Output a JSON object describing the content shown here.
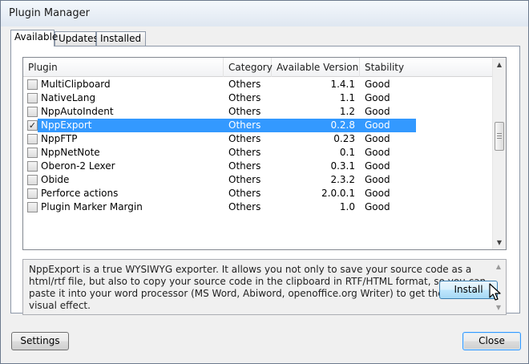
{
  "window": {
    "title": "Plugin Manager"
  },
  "tabs": [
    {
      "label": "Available",
      "active": true
    },
    {
      "label": "Updates",
      "active": false
    },
    {
      "label": "Installed",
      "active": false
    }
  ],
  "plugin_list": {
    "columns": [
      "Plugin",
      "Category",
      "Available Version",
      "Stability"
    ],
    "rows": [
      {
        "name": "MultiClipboard",
        "category": "Others",
        "version": "1.4.1",
        "stability": "Good",
        "checked": false,
        "selected": false
      },
      {
        "name": "NativeLang",
        "category": "Others",
        "version": "1.1",
        "stability": "Good",
        "checked": false,
        "selected": false
      },
      {
        "name": "NppAutoIndent",
        "category": "Others",
        "version": "1.2",
        "stability": "Good",
        "checked": false,
        "selected": false
      },
      {
        "name": "NppExport",
        "category": "Others",
        "version": "0.2.8",
        "stability": "Good",
        "checked": true,
        "selected": true
      },
      {
        "name": "NppFTP",
        "category": "Others",
        "version": "0.23",
        "stability": "Good",
        "checked": false,
        "selected": false
      },
      {
        "name": "NppNetNote",
        "category": "Others",
        "version": "0.1",
        "stability": "Good",
        "checked": false,
        "selected": false
      },
      {
        "name": "Oberon-2 Lexer",
        "category": "Others",
        "version": "0.3.1",
        "stability": "Good",
        "checked": false,
        "selected": false
      },
      {
        "name": "Obide",
        "category": "Others",
        "version": "2.3.2",
        "stability": "Good",
        "checked": false,
        "selected": false
      },
      {
        "name": "Perforce actions",
        "category": "Others",
        "version": "2.0.0.1",
        "stability": "Good",
        "checked": false,
        "selected": false
      },
      {
        "name": "Plugin Marker Margin",
        "category": "Others",
        "version": "1.0",
        "stability": "Good",
        "checked": false,
        "selected": false
      }
    ]
  },
  "description": "NppExport is a true WYSIWYG exporter. It allows you not only to save your source code as a html/rtf file, but also to copy your source code in the clipboard in RTF/HTML format, so you can paste it into your word processor (MS Word, Abiword, openoffice.org Writer) to get the same visual effect.",
  "buttons": {
    "install": "Install",
    "settings": "Settings",
    "close": "Close"
  },
  "icons": {
    "check": "checkmark-icon",
    "up": "scroll-up-arrow-icon",
    "down": "scroll-down-arrow-icon",
    "cursor": "mouse-pointer-icon"
  },
  "colors": {
    "selection": "#3399ff",
    "install_button": "#bee6fd",
    "close_border": "#3399ff"
  }
}
